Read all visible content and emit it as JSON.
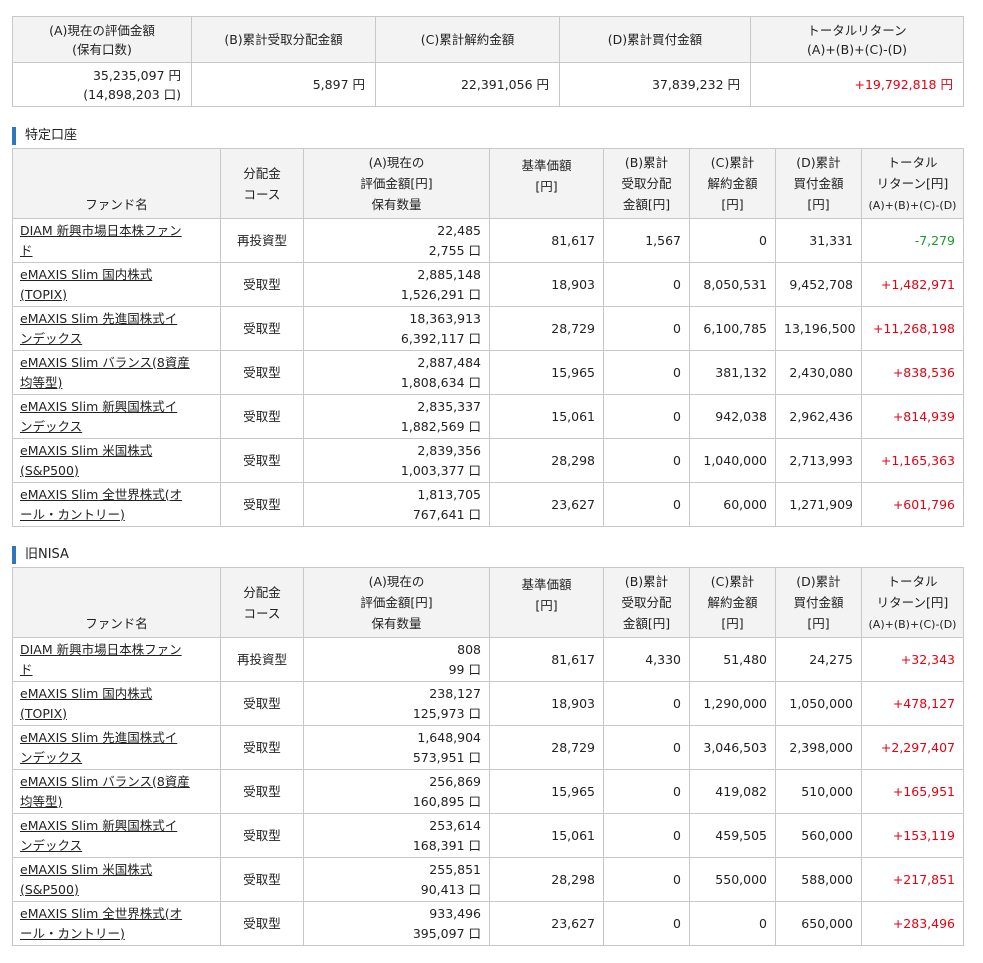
{
  "summary": {
    "headers": [
      [
        "(A)現在の評価金額",
        "(保有口数)"
      ],
      [
        "(B)累計受取分配金額"
      ],
      [
        "(C)累計解約金額"
      ],
      [
        "(D)累計買付金額"
      ],
      [
        "トータルリターン",
        "(A)+(B)+(C)-(D)"
      ]
    ],
    "values": {
      "a_amount": "35,235,097 円",
      "a_units": "(14,898,203 口)",
      "b": "5,897 円",
      "c": "22,391,056 円",
      "d": "37,839,232 円",
      "total": "+19,792,818 円"
    }
  },
  "table_headers": {
    "fund_name": "ファンド名",
    "course": [
      "分配金",
      "コース"
    ],
    "current": [
      "(A)現在の",
      "評価金額[円]",
      "保有数量"
    ],
    "nav": [
      "基準価額",
      "[円]"
    ],
    "dist": [
      "(B)累計",
      "受取分配",
      "金額[円]"
    ],
    "cancel": [
      "(C)累計",
      "解約金額",
      "[円]"
    ],
    "buy": [
      "(D)累計",
      "買付金額",
      "[円]"
    ],
    "total": [
      "トータル",
      "リターン[円]",
      "(A)+(B)+(C)-(D)"
    ]
  },
  "sections": [
    {
      "title": "特定口座",
      "rows": [
        {
          "name1": "DIAM 新興市場日本株ファン",
          "name2": "ド",
          "course": "再投資型",
          "amount": "22,485",
          "units": "2,755 口",
          "nav": "81,617",
          "dist": "1,567",
          "cancel": "0",
          "buy": "31,331",
          "ret": "-7,279",
          "ret_color": "green"
        },
        {
          "name1": "eMAXIS Slim 国内株式",
          "name2": "(TOPIX)",
          "course": "受取型",
          "amount": "2,885,148",
          "units": "1,526,291 口",
          "nav": "18,903",
          "dist": "0",
          "cancel": "8,050,531",
          "buy": "9,452,708",
          "ret": "+1,482,971",
          "ret_color": "red"
        },
        {
          "name1": "eMAXIS Slim 先進国株式イ",
          "name2": "ンデックス",
          "course": "受取型",
          "amount": "18,363,913",
          "units": "6,392,117 口",
          "nav": "28,729",
          "dist": "0",
          "cancel": "6,100,785",
          "buy": "13,196,500",
          "ret": "+11,268,198",
          "ret_color": "red"
        },
        {
          "name1": "eMAXIS Slim バランス(8資産",
          "name2": "均等型)",
          "course": "受取型",
          "amount": "2,887,484",
          "units": "1,808,634 口",
          "nav": "15,965",
          "dist": "0",
          "cancel": "381,132",
          "buy": "2,430,080",
          "ret": "+838,536",
          "ret_color": "red"
        },
        {
          "name1": "eMAXIS Slim 新興国株式イ",
          "name2": "ンデックス",
          "course": "受取型",
          "amount": "2,835,337",
          "units": "1,882,569 口",
          "nav": "15,061",
          "dist": "0",
          "cancel": "942,038",
          "buy": "2,962,436",
          "ret": "+814,939",
          "ret_color": "red"
        },
        {
          "name1": "eMAXIS Slim 米国株式",
          "name2": "(S&P500)",
          "course": "受取型",
          "amount": "2,839,356",
          "units": "1,003,377 口",
          "nav": "28,298",
          "dist": "0",
          "cancel": "1,040,000",
          "buy": "2,713,993",
          "ret": "+1,165,363",
          "ret_color": "red"
        },
        {
          "name1": "eMAXIS Slim 全世界株式(オ",
          "name2": "ール・カントリー)",
          "course": "受取型",
          "amount": "1,813,705",
          "units": "767,641 口",
          "nav": "23,627",
          "dist": "0",
          "cancel": "60,000",
          "buy": "1,271,909",
          "ret": "+601,796",
          "ret_color": "red"
        }
      ]
    },
    {
      "title": "旧NISA",
      "rows": [
        {
          "name1": "DIAM 新興市場日本株ファン",
          "name2": "ド",
          "course": "再投資型",
          "amount": "808",
          "units": "99 口",
          "nav": "81,617",
          "dist": "4,330",
          "cancel": "51,480",
          "buy": "24,275",
          "ret": "+32,343",
          "ret_color": "red"
        },
        {
          "name1": "eMAXIS Slim 国内株式",
          "name2": "(TOPIX)",
          "course": "受取型",
          "amount": "238,127",
          "units": "125,973 口",
          "nav": "18,903",
          "dist": "0",
          "cancel": "1,290,000",
          "buy": "1,050,000",
          "ret": "+478,127",
          "ret_color": "red"
        },
        {
          "name1": "eMAXIS Slim 先進国株式イ",
          "name2": "ンデックス",
          "course": "受取型",
          "amount": "1,648,904",
          "units": "573,951 口",
          "nav": "28,729",
          "dist": "0",
          "cancel": "3,046,503",
          "buy": "2,398,000",
          "ret": "+2,297,407",
          "ret_color": "red"
        },
        {
          "name1": "eMAXIS Slim バランス(8資産",
          "name2": "均等型)",
          "course": "受取型",
          "amount": "256,869",
          "units": "160,895 口",
          "nav": "15,965",
          "dist": "0",
          "cancel": "419,082",
          "buy": "510,000",
          "ret": "+165,951",
          "ret_color": "red"
        },
        {
          "name1": "eMAXIS Slim 新興国株式イ",
          "name2": "ンデックス",
          "course": "受取型",
          "amount": "253,614",
          "units": "168,391 口",
          "nav": "15,061",
          "dist": "0",
          "cancel": "459,505",
          "buy": "560,000",
          "ret": "+153,119",
          "ret_color": "red"
        },
        {
          "name1": "eMAXIS Slim 米国株式",
          "name2": "(S&P500)",
          "course": "受取型",
          "amount": "255,851",
          "units": "90,413 口",
          "nav": "28,298",
          "dist": "0",
          "cancel": "550,000",
          "buy": "588,000",
          "ret": "+217,851",
          "ret_color": "red"
        },
        {
          "name1": "eMAXIS Slim 全世界株式(オ",
          "name2": "ール・カントリー)",
          "course": "受取型",
          "amount": "933,496",
          "units": "395,097 口",
          "nav": "23,627",
          "dist": "0",
          "cancel": "0",
          "buy": "650,000",
          "ret": "+283,496",
          "ret_color": "red"
        }
      ]
    }
  ]
}
